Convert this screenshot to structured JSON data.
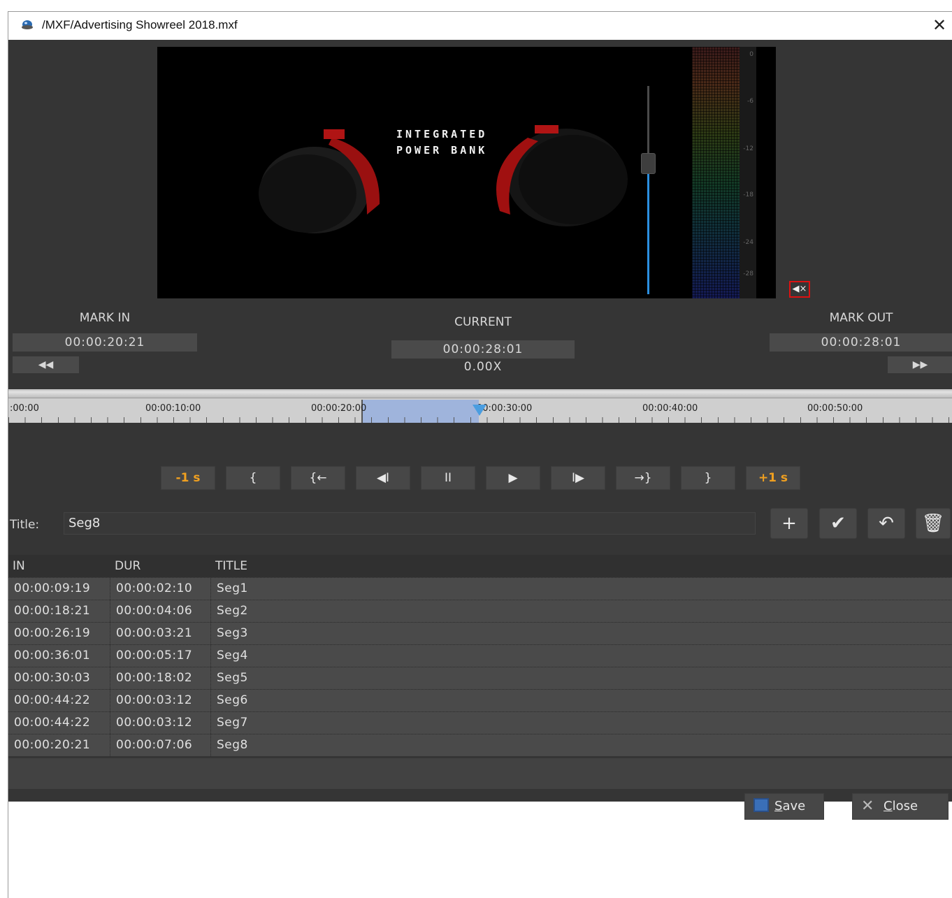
{
  "window": {
    "title": "/MXF/Advertising Showreel 2018.mxf",
    "close_label": "✕"
  },
  "video": {
    "overlay_line1": "INTEGRATED",
    "overlay_line2": "POWER BANK",
    "meter_ticks": [
      "0",
      "-6",
      "-12",
      "-18",
      "-24",
      "-28"
    ],
    "mute_label": "◀×"
  },
  "mark_in": {
    "label": "MARK IN",
    "value": "00:00:20:21",
    "button": "◀◀"
  },
  "current": {
    "label": "CURRENT",
    "value": "00:00:28:01",
    "speed": "0.00X"
  },
  "mark_out": {
    "label": "MARK OUT",
    "value": "00:00:28:01",
    "button": "▶▶"
  },
  "timeline": {
    "labels": [
      ":00:00",
      "00:00:10:00",
      "00:00:20:00",
      "00:00:30:00",
      "00:00:40:00",
      "00:00:50:00"
    ]
  },
  "controls": [
    {
      "name": "minus-1s-button",
      "label": "-1 s",
      "orange": true
    },
    {
      "name": "go-to-mark-in-button",
      "label": "{",
      "orange": false
    },
    {
      "name": "set-mark-in-button",
      "label": "{←",
      "orange": false
    },
    {
      "name": "step-back-button",
      "label": "◀I",
      "orange": false
    },
    {
      "name": "pause-button",
      "label": "II",
      "orange": false
    },
    {
      "name": "play-button",
      "label": "▶",
      "orange": false
    },
    {
      "name": "step-forward-button",
      "label": "I▶",
      "orange": false
    },
    {
      "name": "set-mark-out-button",
      "label": "→}",
      "orange": false
    },
    {
      "name": "go-to-mark-out-button",
      "label": "}",
      "orange": false
    },
    {
      "name": "plus-1s-button",
      "label": "+1 s",
      "orange": true
    }
  ],
  "title_field": {
    "label": "Title:",
    "value": "Seg8"
  },
  "title_buttons": {
    "add": "+",
    "confirm": "✔",
    "undo": "↶",
    "delete": "🗑"
  },
  "table": {
    "headers": [
      "IN",
      "DUR",
      "TITLE"
    ],
    "rows": [
      [
        "00:00:09:19",
        "00:00:02:10",
        "Seg1"
      ],
      [
        "00:00:18:21",
        "00:00:04:06",
        "Seg2"
      ],
      [
        "00:00:26:19",
        "00:00:03:21",
        "Seg3"
      ],
      [
        "00:00:36:01",
        "00:00:05:17",
        "Seg4"
      ],
      [
        "00:00:30:03",
        "00:00:18:02",
        "Seg5"
      ],
      [
        "00:00:44:22",
        "00:00:03:12",
        "Seg6"
      ],
      [
        "00:00:44:22",
        "00:00:03:12",
        "Seg7"
      ],
      [
        "00:00:20:21",
        "00:00:07:06",
        "Seg8"
      ]
    ]
  },
  "footer": {
    "save_key": "S",
    "save_rest": "ave",
    "close_key": "C",
    "close_rest": "lose"
  }
}
